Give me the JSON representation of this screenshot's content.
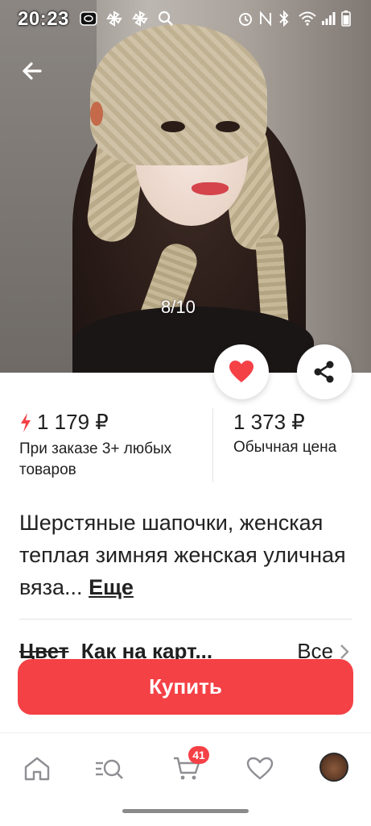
{
  "status_bar": {
    "time": "20:23",
    "icons": [
      "app-icon",
      "pinwheel-icon",
      "pinwheel-icon",
      "search-icon",
      "alarm-icon",
      "nfc-icon",
      "bluetooth-icon",
      "wifi-icon",
      "signal-icon",
      "battery-icon"
    ]
  },
  "gallery": {
    "counter": "8/10"
  },
  "price": {
    "promo_value": "1 179 ₽",
    "promo_note": "При заказе 3+ любых товаров",
    "regular_value": "1 373 ₽",
    "regular_note": "Обычная цена"
  },
  "product": {
    "title": "Шерстяные шапочки, женская теплая зимняя женская уличная вяза...",
    "more_label": "Еще"
  },
  "color_option": {
    "label": "Цвет",
    "value": "Как на карт...",
    "all_label": "Все"
  },
  "buy_button": {
    "label": "Купить"
  },
  "tab_bar": {
    "cart_badge": "41"
  },
  "colors": {
    "accent": "#f44146",
    "text": "#1f1f1f"
  }
}
